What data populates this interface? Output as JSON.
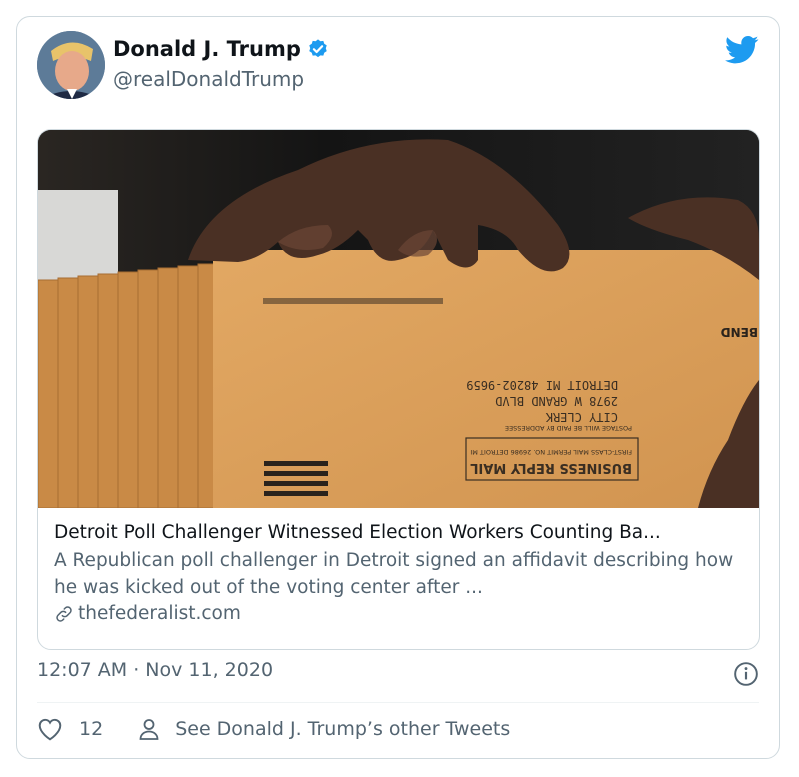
{
  "tweet": {
    "author_name": "Donald J. Trump",
    "author_handle": "@realDonaldTrump",
    "timestamp": "12:07 AM · Nov 11, 2020",
    "like_count": "12",
    "other_tweets_label": "See Donald J. Trump’s other Tweets"
  },
  "link_card": {
    "title": "Detroit Poll Challenger Witnessed Election Workers Counting Ba...",
    "description": "A Republican poll challenger in Detroit signed an affidavit describing how he was kicked out of the voting center after ...",
    "domain": "thefederalist.com",
    "envelope": {
      "line1": "CITY CLERK",
      "line2": "2978 W GRAND BLVD",
      "line3": "DETROIT MI 48202-9659",
      "reply": "BUSINESS REPLY MAIL",
      "permit": "FIRST-CLASS MAIL PERMIT NO. 26986 DETROIT MI",
      "postage": "POSTAGE WILL BE PAID BY ADDRESSEE",
      "bend": "BEND"
    }
  },
  "icons": {
    "verified": "verified-badge-icon",
    "twitter": "twitter-bird-icon",
    "info": "info-icon",
    "like": "heart-icon",
    "person": "person-icon",
    "link": "link-icon"
  },
  "colors": {
    "twitter_blue": "#1d9bf0",
    "secondary_text": "#536471",
    "border": "#cfd9de",
    "envelope": "#d9a05b"
  }
}
